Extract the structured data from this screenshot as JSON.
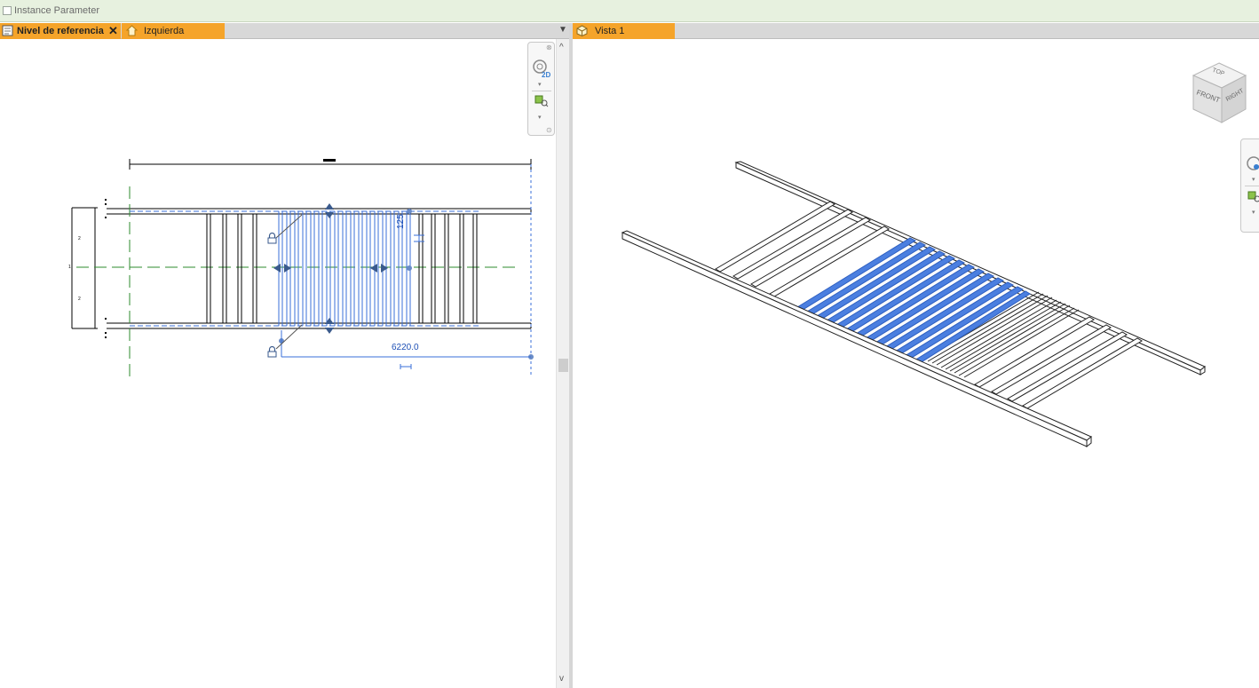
{
  "top_bar": {
    "checkbox_label": "Instance Parameter"
  },
  "left_tabs": [
    {
      "label": "Nivel de referencia",
      "active": true,
      "closable": true
    },
    {
      "label": "Izquierda",
      "active": false
    }
  ],
  "right_tabs": [
    {
      "label": "Vista 1",
      "active": true
    }
  ],
  "plan_view": {
    "dimension_value": "6220.0",
    "vertical_dimension_value": "125",
    "nav_2d_label": "2D"
  },
  "view_cube": {
    "top": "TOP",
    "front": "FRONT",
    "right": "RIGHT"
  },
  "colors": {
    "tab_active": "#f5a42a",
    "selection": "#3a6fd8",
    "grid_green": "#2e8b2e"
  },
  "icons": [
    "checkbox-icon",
    "plan-view-icon",
    "close-icon",
    "elevation-view-icon",
    "3d-view-icon",
    "dropdown-arrow-icon",
    "scroll-up-icon",
    "scroll-down-icon",
    "lock-icon",
    "zoom-icon",
    "steering-wheel-icon"
  ]
}
